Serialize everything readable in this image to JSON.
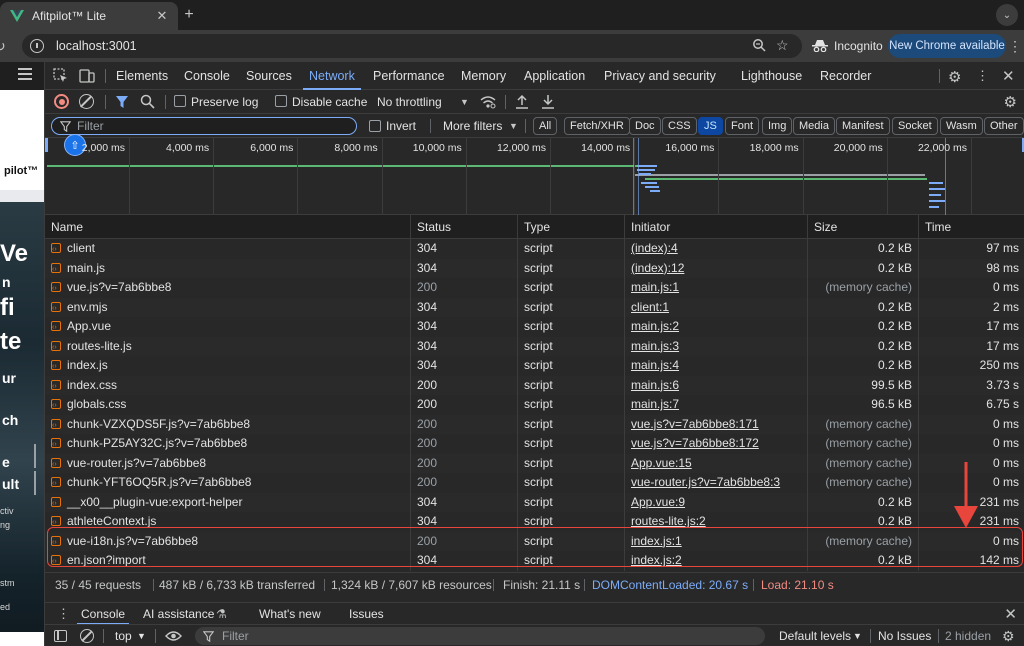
{
  "browser": {
    "tab_title": "Afitpilot™ Lite",
    "tab_close": "✕",
    "new_tab": "+",
    "url": "localhost:3001",
    "incognito_label": "Incognito",
    "new_chrome_label": "New Chrome available",
    "menu_glyph": "⋮"
  },
  "page": {
    "header_text": "pilot™",
    "words": [
      "Ve",
      "n",
      "fi",
      "te",
      "ur",
      "ch",
      "e",
      "ult",
      "ctiv",
      "ng",
      "stm",
      "ed"
    ]
  },
  "devtools": {
    "tabs": [
      "Elements",
      "Console",
      "Sources",
      "Network",
      "Performance",
      "Memory",
      "Application",
      "Privacy and security",
      "Lighthouse",
      "Recorder"
    ],
    "active_tab": "Network",
    "toolbar": {
      "preserve_log": "Preserve log",
      "disable_cache": "Disable cache",
      "throttling": "No throttling"
    },
    "filter": {
      "placeholder": "Filter",
      "invert": "Invert",
      "more_filters": "More filters",
      "chips": [
        "All",
        "Fetch/XHR",
        "Doc",
        "CSS",
        "JS",
        "Font",
        "Img",
        "Media",
        "Manifest",
        "Socket",
        "Wasm",
        "Other"
      ],
      "active_chip": "JS"
    },
    "overview": {
      "ticks": [
        "2,000 ms",
        "4,000 ms",
        "6,000 ms",
        "8,000 ms",
        "10,000 ms",
        "12,000 ms",
        "14,000 ms",
        "16,000 ms",
        "18,000 ms",
        "20,000 ms",
        "22,000 ms"
      ]
    },
    "table": {
      "columns": [
        "Name",
        "Status",
        "Type",
        "Initiator",
        "Size",
        "Time"
      ],
      "rows": [
        {
          "name": "client",
          "status": "304",
          "type": "script",
          "initiator": "(index):4",
          "size": "0.2 kB",
          "time": "97 ms"
        },
        {
          "name": "main.js",
          "status": "304",
          "type": "script",
          "initiator": "(index):12",
          "size": "0.2 kB",
          "time": "98 ms"
        },
        {
          "name": "vue.js?v=7ab6bbe8",
          "status": "200",
          "type": "script",
          "initiator": "main.js:1",
          "size": "(memory cache)",
          "time": "0 ms"
        },
        {
          "name": "env.mjs",
          "status": "304",
          "type": "script",
          "initiator": "client:1",
          "size": "0.2 kB",
          "time": "2 ms"
        },
        {
          "name": "App.vue",
          "status": "304",
          "type": "script",
          "initiator": "main.js:2",
          "size": "0.2 kB",
          "time": "17 ms"
        },
        {
          "name": "routes-lite.js",
          "status": "304",
          "type": "script",
          "initiator": "main.js:3",
          "size": "0.2 kB",
          "time": "17 ms"
        },
        {
          "name": "index.js",
          "status": "304",
          "type": "script",
          "initiator": "main.js:4",
          "size": "0.2 kB",
          "time": "250 ms"
        },
        {
          "name": "index.css",
          "status": "200",
          "type": "script",
          "initiator": "main.js:6",
          "size": "99.5 kB",
          "time": "3.73 s"
        },
        {
          "name": "globals.css",
          "status": "200",
          "type": "script",
          "initiator": "main.js:7",
          "size": "96.5 kB",
          "time": "6.75 s"
        },
        {
          "name": "chunk-VZXQDS5F.js?v=7ab6bbe8",
          "status": "200",
          "type": "script",
          "initiator": "vue.js?v=7ab6bbe8:171",
          "size": "(memory cache)",
          "time": "0 ms"
        },
        {
          "name": "chunk-PZ5AY32C.js?v=7ab6bbe8",
          "status": "200",
          "type": "script",
          "initiator": "vue.js?v=7ab6bbe8:172",
          "size": "(memory cache)",
          "time": "0 ms"
        },
        {
          "name": "vue-router.js?v=7ab6bbe8",
          "status": "200",
          "type": "script",
          "initiator": "App.vue:15",
          "size": "(memory cache)",
          "time": "0 ms"
        },
        {
          "name": "chunk-YFT6OQ5R.js?v=7ab6bbe8",
          "status": "200",
          "type": "script",
          "initiator": "vue-router.js?v=7ab6bbe8:3",
          "size": "(memory cache)",
          "time": "0 ms"
        },
        {
          "name": "__x00__plugin-vue:export-helper",
          "status": "304",
          "type": "script",
          "initiator": "App.vue:9",
          "size": "0.2 kB",
          "time": "231 ms"
        },
        {
          "name": "athleteContext.js",
          "status": "304",
          "type": "script",
          "initiator": "routes-lite.js:2",
          "size": "0.2 kB",
          "time": "231 ms"
        },
        {
          "name": "vue-i18n.js?v=7ab6bbe8",
          "status": "200",
          "type": "script",
          "initiator": "index.js:1",
          "size": "(memory cache)",
          "time": "0 ms"
        },
        {
          "name": "en.json?import",
          "status": "304",
          "type": "script",
          "initiator": "index.js:2",
          "size": "0.2 kB",
          "time": "142 ms"
        }
      ]
    },
    "status_bar": {
      "requests": "35 / 45 requests",
      "transferred": "487 kB / 6,733 kB transferred",
      "resources": "1,324 kB / 7,607 kB resources",
      "finish": "Finish: 21.11 s",
      "dom_loaded": "DOMContentLoaded: 20.67 s",
      "load": "Load: 21.10 s"
    },
    "drawer": {
      "tabs": [
        "Console",
        "AI assistance",
        "What's new",
        "Issues"
      ],
      "active_tab": "Console",
      "context": "top",
      "filter_placeholder": "Filter",
      "levels": "Default levels",
      "issues": "No Issues",
      "hidden": "2 hidden"
    }
  },
  "colors": {
    "accent": "#7cacf8",
    "highlight": "#e8453c",
    "script_icon": "#e8710a"
  }
}
